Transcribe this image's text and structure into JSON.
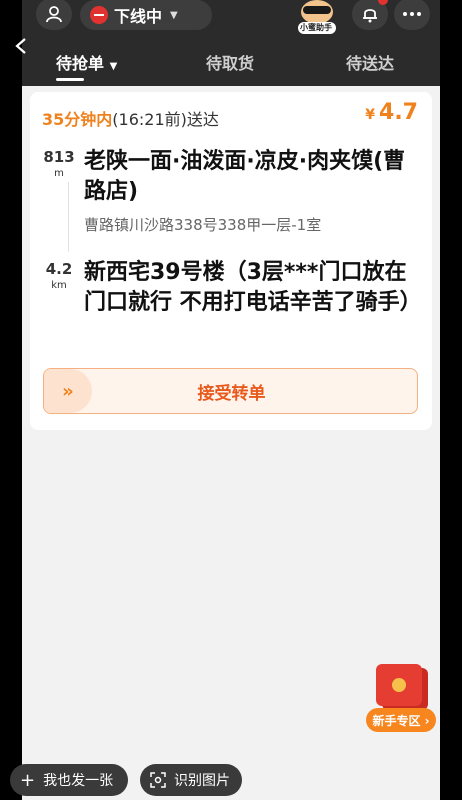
{
  "header": {
    "status_label": "下线中",
    "assistant_label": "小蜜助手",
    "icons": [
      "user-icon",
      "bell-icon",
      "more-icon",
      "back-icon"
    ]
  },
  "tabs": [
    {
      "label": "待抢单",
      "active": true
    },
    {
      "label": "待取货",
      "active": false
    },
    {
      "label": "待送达",
      "active": false
    }
  ],
  "order": {
    "time_highlight": "35分钟内",
    "time_rest": "(16:21前)送达",
    "price_symbol": "¥",
    "price": "4.7",
    "shop_distance": "813",
    "shop_distance_unit": "m",
    "shop_name": "老陕一面·油泼面·凉皮·肉夹馍(曹路店)",
    "shop_address": "曹路镇川沙路338号338甲一层-1室",
    "dest_distance": "4.2",
    "dest_distance_unit": "km",
    "destination": "新西宅39号楼（3层***门口放在门口就行 不用打电话辛苦了骑手）",
    "accept_label": "接受转单",
    "accept_knob": "»"
  },
  "promo": {
    "label": "新手专区 ›"
  },
  "bottom": {
    "share_label": "我也发一张",
    "recognize_label": "识别图片"
  },
  "colors": {
    "accent": "#f0821e",
    "header_bg": "#2b2b2b",
    "danger": "#e0332f"
  }
}
